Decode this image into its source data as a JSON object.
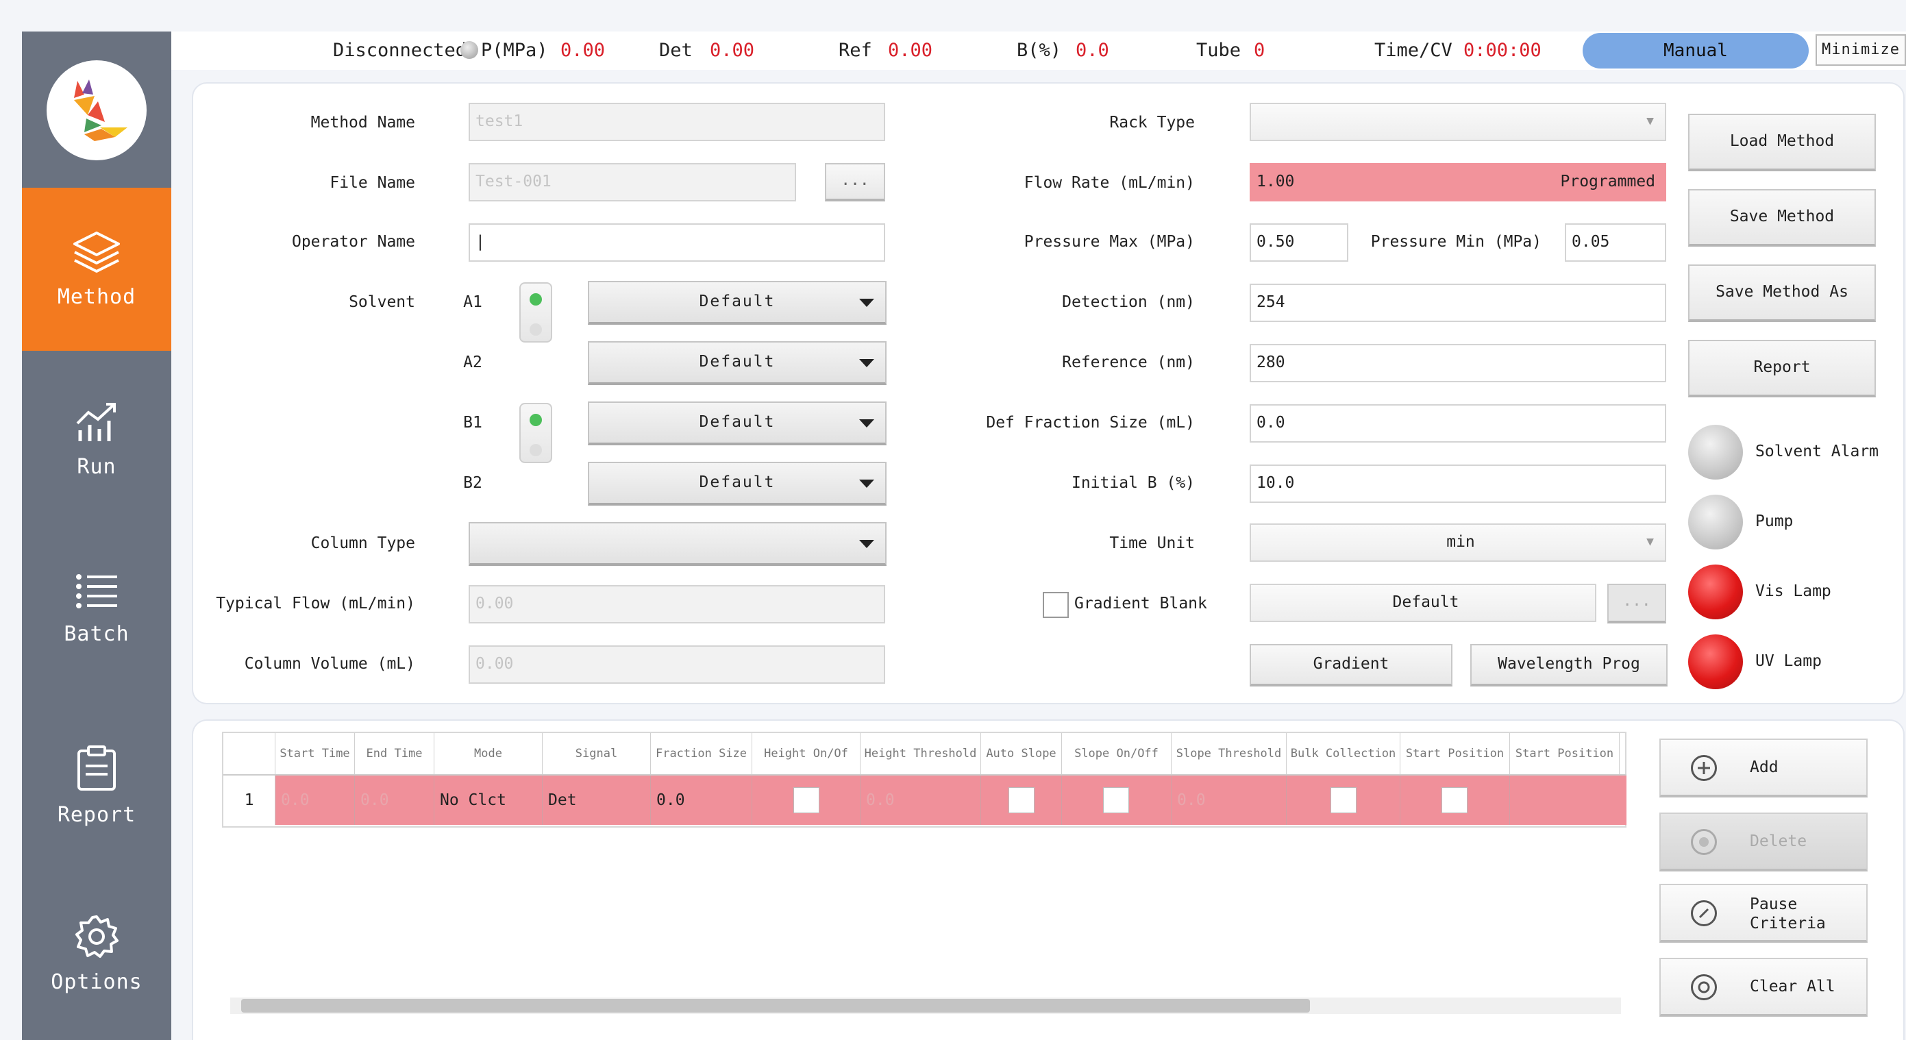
{
  "status": {
    "connection": "Disconnected",
    "pressure_label": "P(MPa)",
    "pressure_value": "0.00",
    "det_label": "Det",
    "det_value": "0.00",
    "ref_label": "Ref",
    "ref_value": "0.00",
    "b_label": "B(%)",
    "b_value": "0.0",
    "tube_label": "Tube",
    "tube_value": "0",
    "time_label": "Time/CV",
    "time_value": "0:00:00",
    "mode": "Manual",
    "minimize": "Minimize"
  },
  "sidebar": {
    "items": [
      {
        "label": "Method",
        "icon": "layers-icon"
      },
      {
        "label": "Run",
        "icon": "chart-icon"
      },
      {
        "label": "Batch",
        "icon": "list-icon"
      },
      {
        "label": "Report",
        "icon": "clipboard-icon"
      },
      {
        "label": "Options",
        "icon": "gear-icon"
      }
    ],
    "active": "Method",
    "active_color": "#f37a1f"
  },
  "method": {
    "method_name_label": "Method Name",
    "method_name_value": "test1",
    "file_name_label": "File Name",
    "file_name_value": "Test-001",
    "browse": "...",
    "operator_label": "Operator Name",
    "operator_value": "|",
    "solvent_label": "Solvent",
    "solvents": [
      {
        "name": "A1",
        "value": "Default",
        "active": true
      },
      {
        "name": "A2",
        "value": "Default",
        "active": false
      },
      {
        "name": "B1",
        "value": "Default",
        "active": true
      },
      {
        "name": "B2",
        "value": "Default",
        "active": false
      }
    ],
    "column_type_label": "Column Type",
    "column_type_value": "",
    "typical_flow_label": "Typical Flow (mL/min)",
    "typical_flow_value": "0.00",
    "column_volume_label": "Column Volume (mL)",
    "column_volume_value": "0.00",
    "rack_type_label": "Rack Type",
    "rack_type_value": "",
    "flow_rate_label": "Flow Rate (mL/min)",
    "flow_rate_value": "1.00",
    "flow_rate_tag": "Programmed",
    "pressure_max_label": "Pressure Max (MPa)",
    "pressure_max_value": "0.50",
    "pressure_min_label": "Pressure Min (MPa)",
    "pressure_min_value": "0.05",
    "detection_label": "Detection (nm)",
    "detection_value": "254",
    "reference_label": "Reference (nm)",
    "reference_value": "280",
    "def_fraction_label": "Def Fraction Size (mL)",
    "def_fraction_value": "0.0",
    "initial_b_label": "Initial B (%)",
    "initial_b_value": "10.0",
    "time_unit_label": "Time Unit",
    "time_unit_value": "min",
    "gradient_blank_label": "Gradient Blank",
    "gradient_blank_value": "Default",
    "gradient_blank_btn": "...",
    "gradient_btn": "Gradient",
    "wavelength_btn": "Wavelength Prog"
  },
  "actions": {
    "load": "Load Method",
    "save": "Save Method",
    "save_as": "Save Method As",
    "report": "Report"
  },
  "lamps": [
    {
      "label": "Solvent Alarm",
      "state": "off",
      "color": "#c7c7c7"
    },
    {
      "label": "Pump",
      "state": "off",
      "color": "#c7c7c7"
    },
    {
      "label": "Vis Lamp",
      "state": "on",
      "color": "#e01818"
    },
    {
      "label": "UV Lamp",
      "state": "on",
      "color": "#e01818"
    }
  ],
  "table": {
    "headers": [
      "",
      "Start Time",
      "End Time",
      "Mode",
      "Signal",
      "Fraction Size",
      "Height On/Of",
      "Height Threshold",
      "Auto Slope",
      "Slope On/Off",
      "Slope Threshold",
      "Bulk Collection",
      "Start Position",
      "Start Position"
    ],
    "rows": [
      {
        "index": "1",
        "start": "0.0",
        "end": "0.0",
        "mode": "No Clct",
        "signal": "Det",
        "fraction": "0.0",
        "height_threshold": "0.0",
        "slope_threshold": "0.0",
        "row_color": "#f0909a"
      }
    ]
  },
  "table_buttons": {
    "add": "Add",
    "delete": "Delete",
    "pause_line1": "Pause",
    "pause_line2": "Criteria",
    "clear": "Clear All"
  }
}
